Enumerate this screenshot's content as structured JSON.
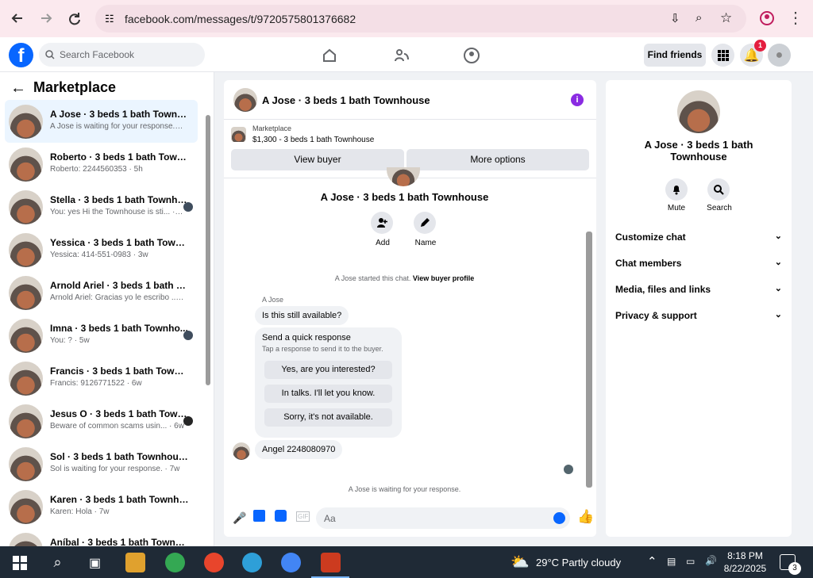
{
  "browser": {
    "url": "facebook.com/messages/t/9720575801376682",
    "icons": [
      "back-arrow-icon",
      "forward-arrow-icon",
      "reload-icon",
      "site-info-icon",
      "install-icon",
      "zoom-icon",
      "star-icon",
      "profile-icon",
      "menu-icon"
    ]
  },
  "facebook": {
    "search_placeholder": "Search Facebook",
    "find_friends": "Find friends",
    "notification_count": "1"
  },
  "marketplace": {
    "title": "Marketplace",
    "conversations": [
      {
        "title": "A Jose · 3 beds 1 bath Townhouse",
        "subtitle": "A Jose is waiting for your response. · 1h",
        "active": true
      },
      {
        "title": "Roberto · 3 beds 1 bath Townho...",
        "subtitle": "Roberto: 2244560353 · 5h"
      },
      {
        "title": "Stella · 3 beds 1 bath Townho...",
        "subtitle": "You: yes Hi the Townhouse is sti... · 2w"
      },
      {
        "title": "Yessica · 3 beds 1 bath Townhou...",
        "subtitle": "Yessica: 414-551-0983 · 3w"
      },
      {
        "title": "Arnold Ariel · 3 beds 1 bath Tow...",
        "subtitle": "Arnold Ariel: Gracias yo le escribo ... · 3w"
      },
      {
        "title": "Imna · 3 beds 1 bath Townho...",
        "subtitle": "You: ? · 5w"
      },
      {
        "title": "Francis · 3 beds 1 bath Townhou...",
        "subtitle": "Francis: 9126771522 · 6w"
      },
      {
        "title": "Jesus O · 3 beds 1 bath Town...",
        "subtitle": "Beware of common scams usin... · 6w"
      },
      {
        "title": "Sol · 3 beds 1 bath Townhouse",
        "subtitle": "Sol is waiting for your response. · 7w"
      },
      {
        "title": "Karen · 3 beds 1 bath Townhouse",
        "subtitle": "Karen: Hola · 7w"
      },
      {
        "title": "Aníbal · 3 beds 1 bath Townhouse",
        "subtitle": ""
      }
    ]
  },
  "chat": {
    "header_title": "A Jose · 3 beds 1 bath Townhouse",
    "marketplace_label": "Marketplace",
    "listing": "$1,300 - 3 beds 1 bath Townhouse",
    "view_buyer": "View buyer",
    "more_options": "More options",
    "profile_title": "A Jose · 3 beds 1 bath Townhouse",
    "add": "Add",
    "name": "Name",
    "started": "A Jose started this chat.",
    "view_profile": "View buyer profile",
    "sender": "A Jose",
    "message_1": "Is this still available?",
    "quick_title": "Send a quick response",
    "quick_subtitle": "Tap a response to send it to the buyer.",
    "quick_replies": [
      "Yes, are you interested?",
      "In talks. I'll let you know.",
      "Sorry, it's not available."
    ],
    "message_2": "Angel 2248080970",
    "waiting": "A Jose is waiting for your response.",
    "composer_placeholder": "Aa"
  },
  "details": {
    "title": "A Jose · 3 beds 1 bath Townhouse",
    "mute": "Mute",
    "search": "Search",
    "sections": [
      "Customize chat",
      "Chat members",
      "Media, files and links",
      "Privacy & support"
    ]
  },
  "taskbar": {
    "weather": "29°C  Partly cloudy",
    "time": "8:18 PM",
    "date": "8/22/2025",
    "notification_count": "3"
  }
}
